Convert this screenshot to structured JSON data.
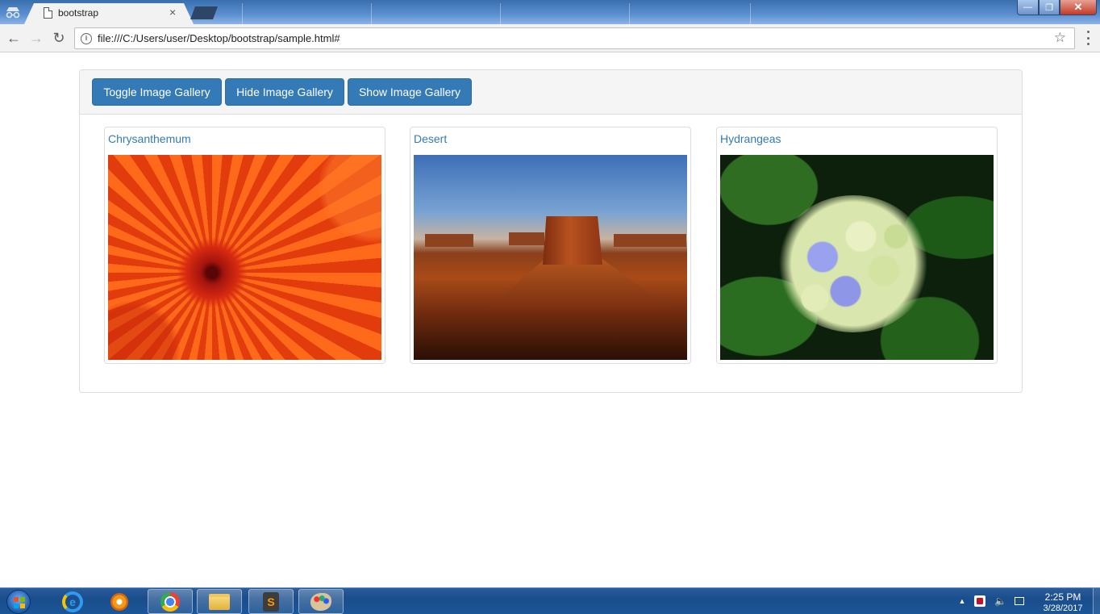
{
  "browser": {
    "active_tab": {
      "title": "bootstrap",
      "close": "×"
    },
    "url": "file:///C:/Users/user/Desktop/bootstrap/sample.html#",
    "nav": {
      "back": "←",
      "forward": "→",
      "reload": "↻"
    },
    "icons": {
      "info": "i",
      "star": "☆",
      "menu": "kebab-menu-icon"
    },
    "window_controls": {
      "minimize": "—",
      "maximize": "❐",
      "close": "✕"
    }
  },
  "page": {
    "buttons": {
      "toggle": "Toggle Image Gallery",
      "hide": "Hide Image Gallery",
      "show": "Show Image Gallery"
    },
    "gallery": [
      {
        "caption": "Chrysanthemum"
      },
      {
        "caption": "Desert"
      },
      {
        "caption": "Hydrangeas"
      }
    ],
    "colors": {
      "button_bg": "#337ab7",
      "button_border": "#2e6da4",
      "link": "#337ab7",
      "panel_heading_bg": "#f5f5f5",
      "panel_border": "#dddddd"
    }
  },
  "taskbar": {
    "clock_time": "2:25 PM",
    "clock_date": "3/28/2017",
    "sublime_glyph": "S",
    "ie_glyph": "e"
  }
}
